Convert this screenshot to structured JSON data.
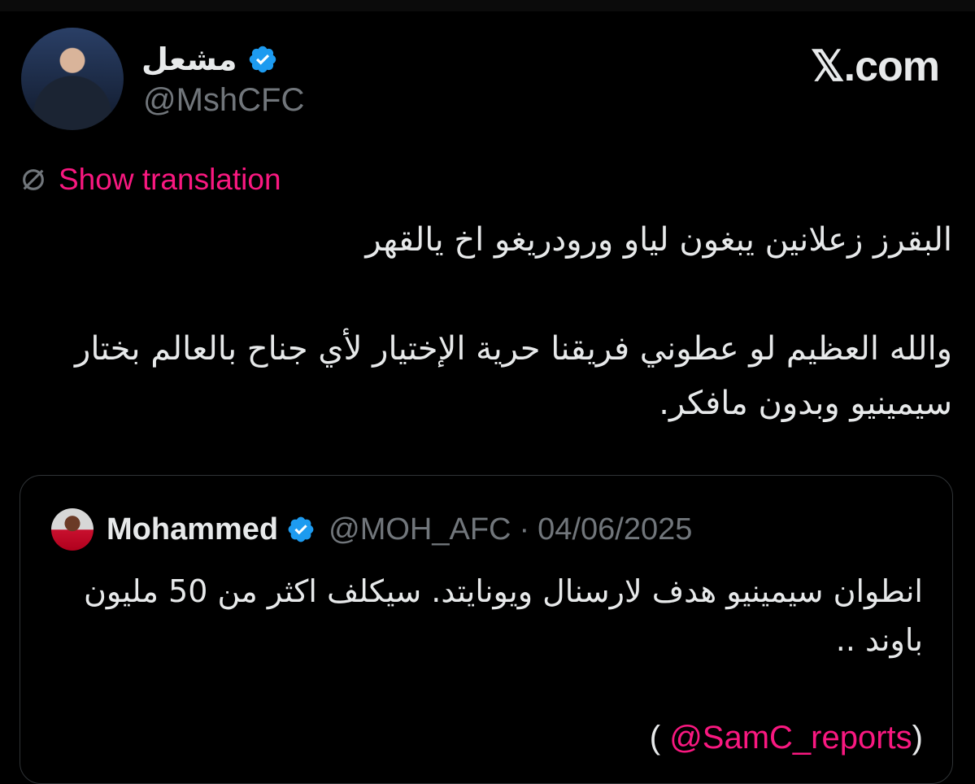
{
  "brand": "𝕏.com",
  "author": {
    "name": "مشعل",
    "handle": "@MshCFC",
    "verified_icon": "verified-badge-icon"
  },
  "translate": {
    "label": "Show translation",
    "icon": "globe-icon"
  },
  "tweet": {
    "lines": [
      "البقرز زعلانين يبغون لياو ورودريغو اخ يالقهر",
      "",
      "والله العظيم لو عطوني فريقنا حرية الإختيار لأي جناح بالعالم بختار سيمينيو وبدون مافكر."
    ]
  },
  "quote": {
    "name": "Mohammed",
    "handle": "@MOH_AFC",
    "separator": "·",
    "date": "04/06/2025",
    "lines": [
      "انطوان سيمينيو هدف لارسنال ويونايتد. سيكلف اكثر من 50 مليون باوند ..",
      ""
    ],
    "mention_open": "( ",
    "mention": "@SamC_reports",
    "mention_close": ")"
  },
  "colors": {
    "background": "#000000",
    "text": "#e7e9ea",
    "muted": "#71767b",
    "accent": "#f91880",
    "verified": "#1d9bf0"
  }
}
